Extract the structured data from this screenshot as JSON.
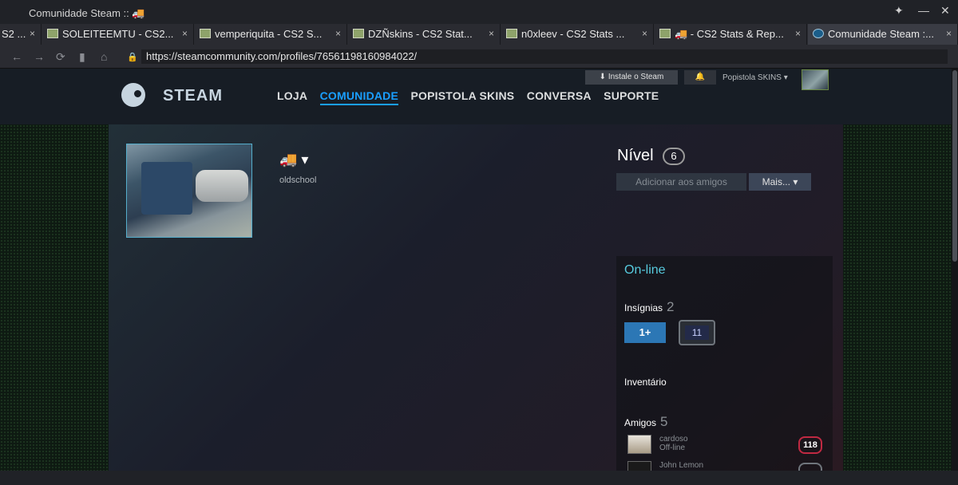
{
  "window": {
    "title": "Comunidade Steam :: 🚚"
  },
  "tabs": [
    {
      "label": "S2 ...",
      "close": "×"
    },
    {
      "label": "SOLEITEEMTU - CS2...",
      "close": "×"
    },
    {
      "label": "vemperiquita - CS2 S...",
      "close": "×"
    },
    {
      "label": "DZÑskins - CS2 Stat...",
      "close": "×"
    },
    {
      "label": "n0xleev - CS2 Stats ...",
      "close": "×"
    },
    {
      "label": "🚚 - CS2 Stats & Rep...",
      "close": "×"
    },
    {
      "label": "Comunidade Steam :...",
      "close": "×"
    }
  ],
  "browser": {
    "url": "https://steamcommunity.com/profiles/76561198160984022/"
  },
  "steam_header": {
    "logo_text": "STEAM",
    "nav": [
      "LOJA",
      "COMUNIDADE",
      "POPISTOLA SKINS",
      "CONVERSA",
      "SUPORTE"
    ],
    "install_label": "Instale o Steam",
    "account_name": "Popistola SKINS ▾"
  },
  "profile": {
    "persona_name": "🚚 ▾",
    "real_name": "oldschool",
    "level_label": "Nível",
    "level": "6",
    "add_friend_label": "Adicionar aos amigos",
    "more_label": "Mais... ▾",
    "status": "On-line",
    "badges_label": "Insígnias",
    "badges_count": "2",
    "badge1_text": "1+",
    "badge2_text": "11",
    "inventory_label": "Inventário",
    "friends_label": "Amigos",
    "friends_count": "5",
    "friends": [
      {
        "name": "cardoso",
        "status": "Off-line",
        "level": "118"
      },
      {
        "name": "John Lemon",
        "status": "",
        "level": ""
      }
    ]
  },
  "colors": {
    "accent": "#1a9fff",
    "online": "#57cbde",
    "header_bg": "#171d25"
  }
}
